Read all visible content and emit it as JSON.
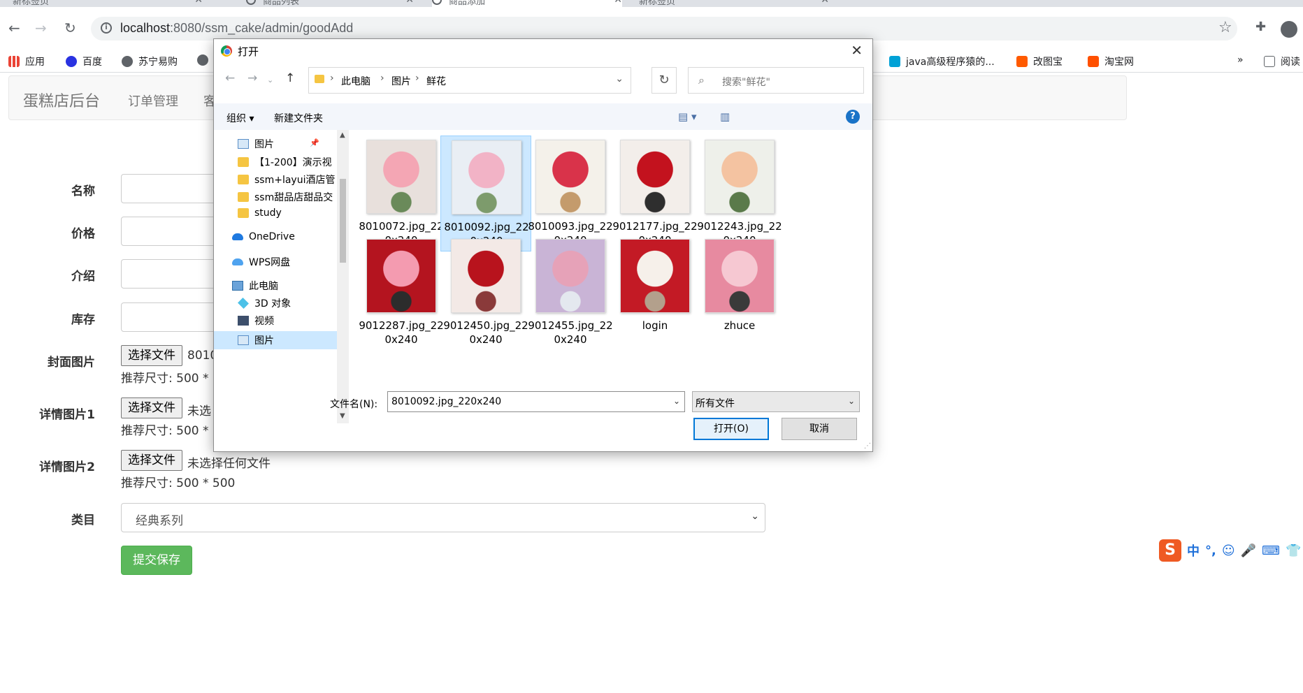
{
  "browser": {
    "tabs": [
      {
        "title": "新标签页"
      },
      {
        "title": "商品列表"
      },
      {
        "title": "商品添加"
      },
      {
        "title": "新标签页"
      }
    ],
    "url_host": "localhost",
    "url_rest": ":8080/ssm_cake/admin/goodAdd",
    "bookmarks": [
      "应用",
      "百度",
      "苏宁易购",
      "java高级程序猿的...",
      "改图宝",
      "淘宝网"
    ],
    "bookmarks_more": "»",
    "reading_list": "阅读"
  },
  "page": {
    "brand": "蛋糕店后台",
    "nav": [
      "订单管理",
      "客"
    ],
    "labels": {
      "name": "名称",
      "price": "价格",
      "intro": "介绍",
      "stock": "库存",
      "cover": "封面图片",
      "detail1": "详情图片1",
      "detail2": "详情图片2",
      "category": "类目"
    },
    "choose_file": "选择文件",
    "cover_file_text": "8010",
    "no_file_text_partial": "未选",
    "no_file_text": "未选择任何文件",
    "hint_partial": "推荐尺寸: 500 * 5",
    "hint": "推荐尺寸: 500 * 500",
    "category_value": "经典系列",
    "submit": "提交保存"
  },
  "ime": {
    "logo": "S",
    "items": [
      "中",
      "°,",
      "☺",
      "🎤",
      "⌨",
      "👕"
    ]
  },
  "dialog": {
    "title": "打开",
    "breadcrumb": [
      "此电脑",
      "图片",
      "鲜花"
    ],
    "search_placeholder": "搜索\"鲜花\"",
    "organize": "组织 ▾",
    "new_folder": "新建文件夹",
    "help": "?",
    "tree": [
      {
        "label": "图片",
        "icon": "pictures-icon"
      },
      {
        "label": "【1-200】演示视",
        "icon": "folder-icon"
      },
      {
        "label": "ssm+layui酒店管",
        "icon": "folder-icon"
      },
      {
        "label": "ssm甜品店甜品交",
        "icon": "folder-icon"
      },
      {
        "label": "study",
        "icon": "folder-icon"
      },
      {
        "label": "OneDrive",
        "icon": "onedrive-icon"
      },
      {
        "label": "WPS网盘",
        "icon": "wps-cloud-icon"
      },
      {
        "label": "此电脑",
        "icon": "this-pc-icon"
      },
      {
        "label": "3D 对象",
        "icon": "3d-objects-icon"
      },
      {
        "label": "视频",
        "icon": "videos-icon"
      },
      {
        "label": "图片",
        "icon": "pictures-icon"
      }
    ],
    "files": [
      {
        "name": "8010072.jpg_220x240",
        "colors": [
          "#f4a6b4",
          "#e8e0dc",
          "#6a8a5a"
        ]
      },
      {
        "name": "8010092.jpg_220x240",
        "colors": [
          "#f2b3c6",
          "#e9eef4",
          "#7d9b6c"
        ]
      },
      {
        "name": "8010093.jpg_220x240",
        "colors": [
          "#d9334a",
          "#f4f1ea",
          "#c49b6c"
        ]
      },
      {
        "name": "9012177.jpg_220x240",
        "colors": [
          "#c3121e",
          "#f3eeea",
          "#2e2e2e"
        ]
      },
      {
        "name": "9012243.jpg_220x240",
        "colors": [
          "#f4c3a1",
          "#eef0ea",
          "#5a7a4a"
        ]
      },
      {
        "name": "9012287.jpg_220x240",
        "colors": [
          "#f49bb0",
          "#b4141f",
          "#2c2c2c"
        ]
      },
      {
        "name": "9012450.jpg_220x240",
        "colors": [
          "#b8131d",
          "#f3e9e6",
          "#8a3a3a"
        ]
      },
      {
        "name": "9012455.jpg_220x240",
        "colors": [
          "#e6a2b8",
          "#c9b4d6",
          "#e4e8ef"
        ]
      },
      {
        "name": "login",
        "colors": [
          "#f6f0ea",
          "#c31a25",
          "#b3a08c"
        ]
      },
      {
        "name": "zhuce",
        "colors": [
          "#f6c8d2",
          "#e78aa0",
          "#3a3a3a"
        ]
      }
    ],
    "selected_file_index": 1,
    "filename_label": "文件名(N):",
    "filename_value": "8010092.jpg_220x240",
    "filetype_value": "所有文件",
    "open_button": "打开(O)",
    "cancel_button": "取消"
  }
}
